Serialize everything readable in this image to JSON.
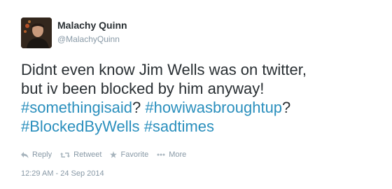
{
  "user": {
    "display_name": "Malachy Quinn",
    "handle": "@MalachyQuinn"
  },
  "tweet": {
    "text_line1": "Didnt even know Jim Wells was on twitter,",
    "text_line2": "but iv been blocked by him anyway!",
    "hashtag1": "#somethingisaid",
    "sep1": "? ",
    "hashtag2": "#howiwasbroughtup",
    "sep2": "?",
    "hashtag3": "#BlockedByWells",
    "sep3": " ",
    "hashtag4": "#sadtimes"
  },
  "actions": {
    "reply": {
      "label": "Reply",
      "icon": "reply-icon"
    },
    "retweet": {
      "label": "Retweet",
      "icon": "retweet-icon"
    },
    "favorite": {
      "label": "Favorite",
      "icon": "star-icon"
    },
    "more": {
      "label": "More",
      "icon": "more-dots-icon"
    }
  },
  "timestamp": "12:29 AM - 24 Sep 2014",
  "colors": {
    "hashtag": "#2a8fbd",
    "text": "#292f33",
    "muted": "#8899a6"
  }
}
